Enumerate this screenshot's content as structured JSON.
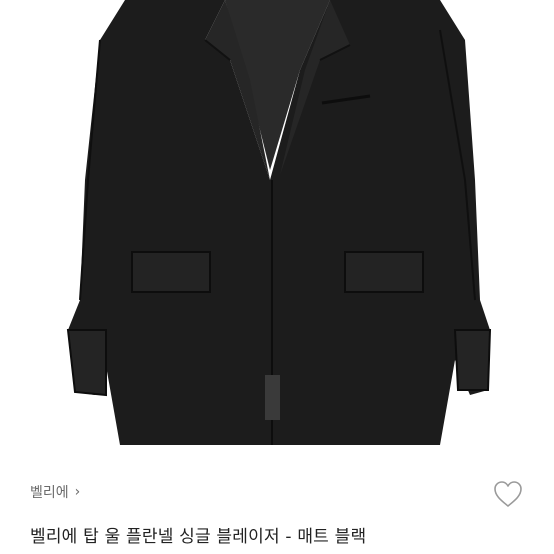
{
  "product": {
    "image_alt_icon": "blazer-photo",
    "brand_name": "벨리에",
    "brand_chevron": "›",
    "title": "벨리에 탑 울 플란넬 싱글 블레이저 - 매트 블랙",
    "like_icon": "heart-outline-icon"
  }
}
